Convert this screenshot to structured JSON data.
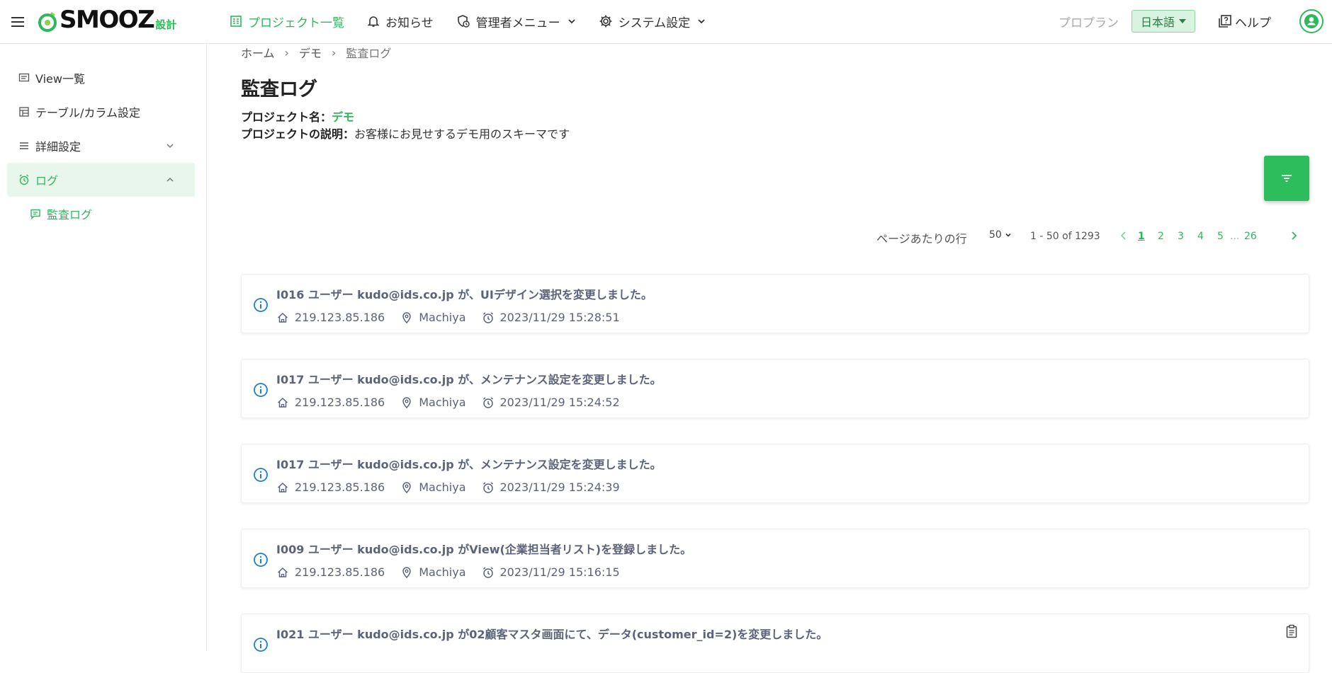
{
  "header": {
    "logo": "SMOOZ",
    "logo_sub": "設計",
    "nav": [
      {
        "label": "プロジェクト一覧",
        "icon": "project-list-icon",
        "active": true
      },
      {
        "label": "お知らせ",
        "icon": "bell-icon"
      },
      {
        "label": "管理者メニュー",
        "icon": "admin-icon"
      },
      {
        "label": "システム設定",
        "icon": "gear-icon"
      }
    ],
    "plan": "プロプラン",
    "language": "日本語",
    "help": "ヘルプ"
  },
  "sidebar": {
    "items": [
      {
        "label": "View一覧",
        "icon": "view-list-icon"
      },
      {
        "label": "テーブル/カラム設定",
        "icon": "table-icon"
      },
      {
        "label": "詳細設定",
        "icon": "list-icon"
      },
      {
        "label": "ログ",
        "icon": "alarm-icon"
      }
    ],
    "sub_items": [
      {
        "label": "監査ログ",
        "icon": "comment-icon"
      }
    ]
  },
  "breadcrumb": [
    "ホーム",
    "デモ",
    "監査ログ"
  ],
  "page": {
    "title": "監査ログ",
    "project_name_label": "プロジェクト名：",
    "project_name": "デモ",
    "project_desc_label": "プロジェクトの説明：",
    "project_desc": "お客様にお見せするデモ用のスキーマです"
  },
  "pagination": {
    "rows_label": "ページあたりの行",
    "rows_per_page": "50",
    "range": "1 - 50 of 1293",
    "pages": [
      "1",
      "2",
      "3",
      "4",
      "5"
    ],
    "ellipsis": "...",
    "last_page": "26",
    "current": "1"
  },
  "logs": [
    {
      "message": "I016 ユーザー kudo@ids.co.jp が、UIデザイン選択を変更しました。",
      "ip": "219.123.85.186",
      "location": "Machiya",
      "timestamp": "2023/11/29 15:28:51"
    },
    {
      "message": "I017 ユーザー kudo@ids.co.jp が、メンテナンス設定を変更しました。",
      "ip": "219.123.85.186",
      "location": "Machiya",
      "timestamp": "2023/11/29 15:24:52"
    },
    {
      "message": "I017 ユーザー kudo@ids.co.jp が、メンテナンス設定を変更しました。",
      "ip": "219.123.85.186",
      "location": "Machiya",
      "timestamp": "2023/11/29 15:24:39"
    },
    {
      "message": "I009 ユーザー kudo@ids.co.jp がView(企業担当者リスト)を登録しました。",
      "ip": "219.123.85.186",
      "location": "Machiya",
      "timestamp": "2023/11/29 15:16:15"
    },
    {
      "message": "I021 ユーザー kudo@ids.co.jp が02顧客マスタ画面にて、データ(customer_id=2)を変更しました。"
    }
  ],
  "colors": {
    "brand": "#2fb85b",
    "filter_button": "#2ebd5c",
    "info_icon": "#1a7fd4"
  }
}
